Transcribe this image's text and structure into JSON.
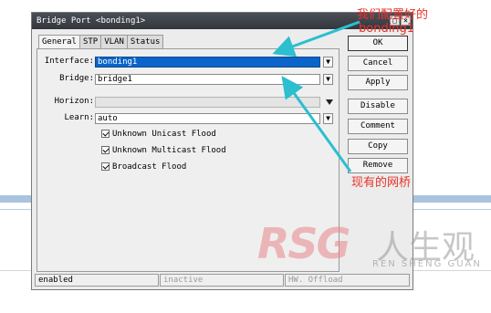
{
  "window": {
    "title": "Bridge Port <bonding1>",
    "min_btn": "_",
    "max_btn": "□",
    "close_btn": "×"
  },
  "tabs": [
    "General",
    "STP",
    "VLAN",
    "Status"
  ],
  "form": {
    "interface_label": "Interface:",
    "interface_value": "bonding1",
    "bridge_label": "Bridge:",
    "bridge_value": "bridge1",
    "horizon_label": "Horizon:",
    "horizon_value": "",
    "learn_label": "Learn:",
    "learn_value": "auto",
    "checkboxes": [
      {
        "label": "Unknown Unicast Flood",
        "checked": true
      },
      {
        "label": "Unknown Multicast Flood",
        "checked": true
      },
      {
        "label": "Broadcast Flood",
        "checked": true
      }
    ]
  },
  "buttons": {
    "ok": "OK",
    "cancel": "Cancel",
    "apply": "Apply",
    "disable": "Disable",
    "comment": "Comment",
    "copy": "Copy",
    "remove": "Remove"
  },
  "status_bar": {
    "state": "enabled",
    "activity": "inactive",
    "offload": "HW. Offload"
  },
  "annotations": {
    "note_top_line1": "我们配置好的",
    "note_top_line2": "bonding1",
    "note_bottom": "现有的网桥",
    "color": "#e8332a",
    "arrow_color": "#2bbfd0"
  },
  "watermark": {
    "brand": "RSG",
    "name_cn": "人生观",
    "name_en": "REN SHENG GUAN"
  }
}
